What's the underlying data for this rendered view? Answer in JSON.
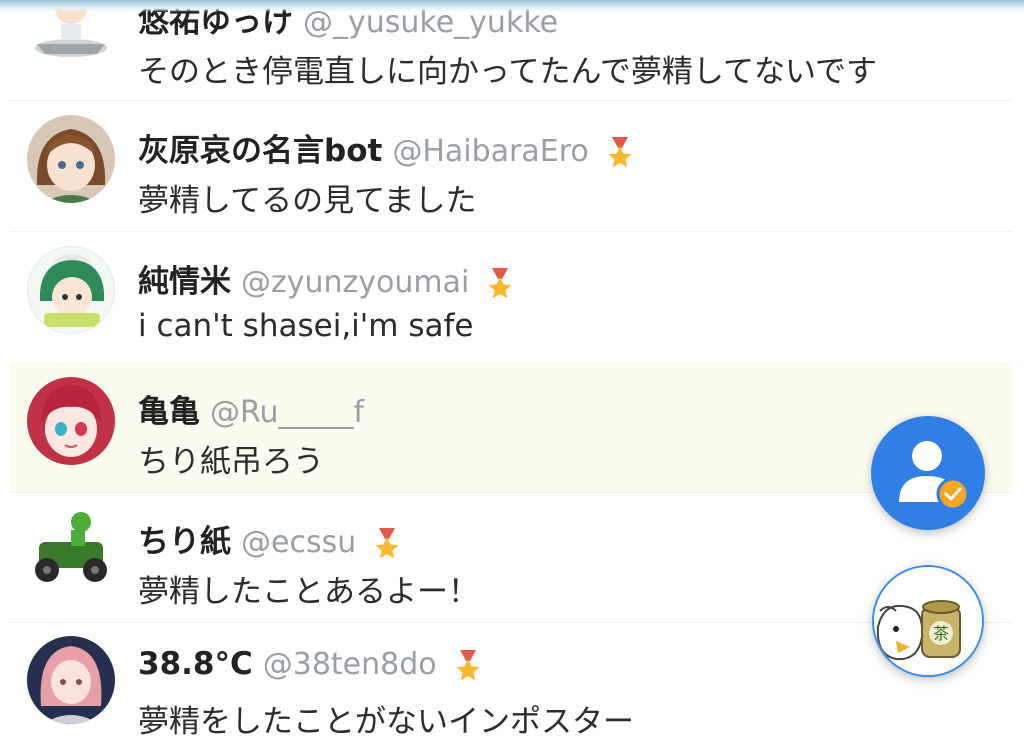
{
  "posts": [
    {
      "display_name": "悠祐ゆっけ",
      "handle": "@_yusuke_yukke",
      "message": "そのとき停電直しに向かってたんで夢精してないです",
      "badge": false,
      "highlighted": false,
      "avatar": "robot-character-avatar"
    },
    {
      "display_name": "灰原哀の名言bot",
      "handle": "@HaibaraEro",
      "message": "夢精してるの見てました",
      "badge": true,
      "highlighted": false,
      "avatar": "anime-girl-brown-hair-avatar"
    },
    {
      "display_name": "純情米",
      "handle": "@zyunzyoumai",
      "message": "i can't shasei,i'm safe",
      "badge": true,
      "highlighted": false,
      "avatar": "green-hair-chibi-avatar"
    },
    {
      "display_name": "亀亀",
      "handle": "@Ru_____f",
      "message": "ちり紙吊ろう",
      "badge": false,
      "highlighted": true,
      "avatar": "red-hair-anime-girl-avatar"
    },
    {
      "display_name": "ちり紙",
      "handle": "@ecssu",
      "message": "夢精したことあるよー！",
      "badge": true,
      "highlighted": false,
      "avatar": "dinosaur-kart-avatar"
    },
    {
      "display_name": "38.8°C",
      "handle": "@38ten8do",
      "message": "夢精をしたことがないインポスター",
      "badge": true,
      "highlighted": false,
      "avatar": "pink-hair-girl-avatar"
    }
  ],
  "fab": {
    "follow_icon": "user-check-icon",
    "character_icon": "tea-bird-character-icon",
    "character_text": "茶"
  },
  "colors": {
    "accent": "#2f7fe6",
    "badge": "#f5b82e",
    "highlight_row": "#fbfcef",
    "handle": "#9a9fa5"
  }
}
